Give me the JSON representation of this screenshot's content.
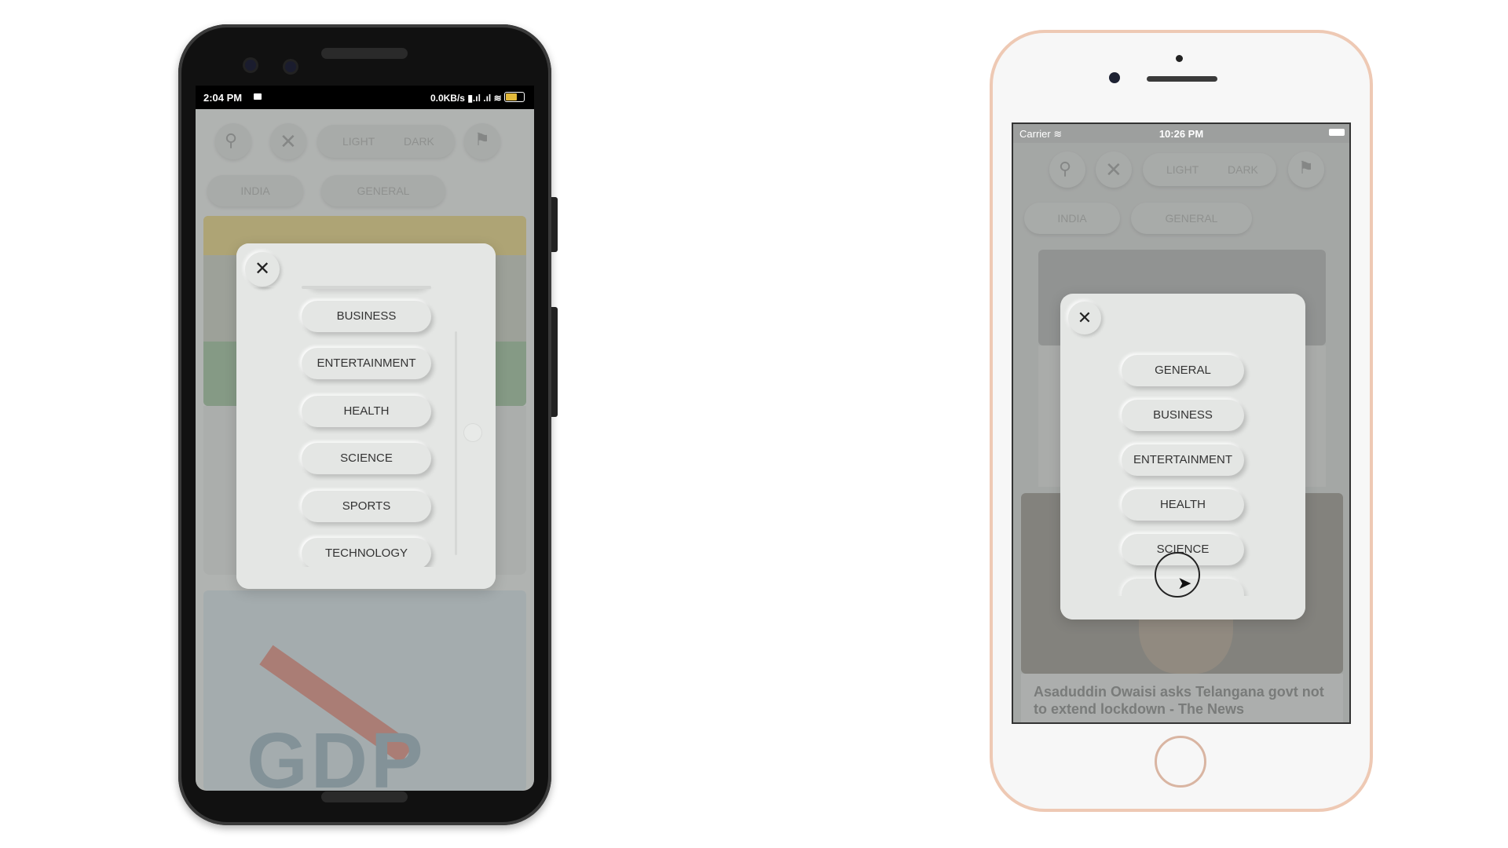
{
  "android": {
    "status": {
      "time": "2:04 PM",
      "network": "0.0KB/s"
    },
    "toolbar": {
      "light": "LIGHT",
      "dark": "DARK"
    },
    "chips": [
      "INDIA",
      "GENERAL"
    ],
    "modal": {
      "categories": [
        "BUSINESS",
        "ENTERTAINMENT",
        "HEALTH",
        "SCIENCE",
        "SPORTS",
        "TECHNOLOGY"
      ]
    }
  },
  "iphone": {
    "status": {
      "carrier": "Carrier",
      "time": "10:26 PM"
    },
    "toolbar": {
      "light": "LIGHT",
      "dark": "DARK"
    },
    "chips": [
      "INDIA",
      "GENERAL"
    ],
    "modal": {
      "categories": [
        "GENERAL",
        "BUSINESS",
        "ENTERTAINMENT",
        "HEALTH",
        "SCIENCE"
      ]
    },
    "headline": "Asaduddin Owaisi asks Telangana govt not to extend lockdown - The News"
  },
  "colors": {
    "modal": "#e4e6e4",
    "dim": "#b9bbba",
    "iphone_frame": "#eec9b4"
  },
  "icons": [
    "search-icon",
    "close-icon",
    "bookmark-icon",
    "wifi-icon",
    "battery-icon",
    "cursor-icon"
  ]
}
